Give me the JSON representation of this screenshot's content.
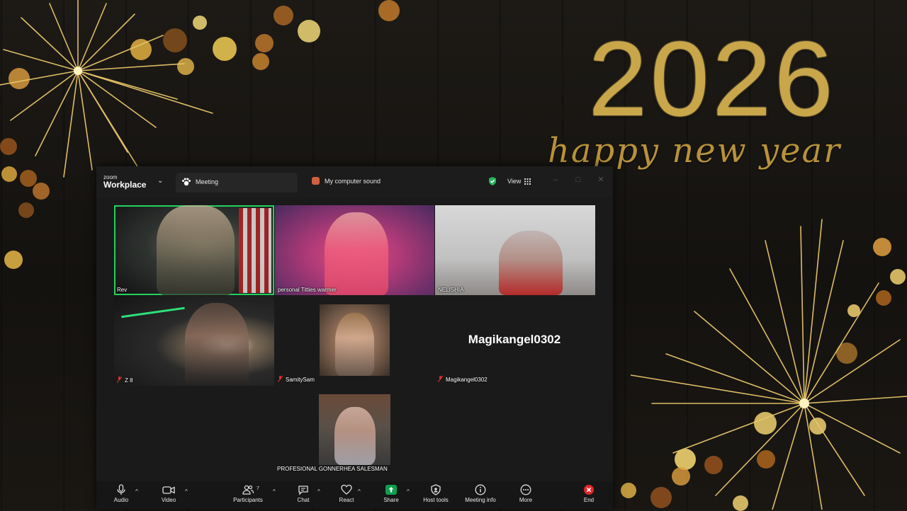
{
  "background": {
    "year": "2026",
    "greeting": "happy new year"
  },
  "app": {
    "brand_small": "zoom",
    "brand_big": "Workplace",
    "tabs": [
      {
        "label": "Meeting"
      },
      {
        "label": "My computer sound"
      }
    ],
    "view_label": "View"
  },
  "participants": [
    {
      "name": "Rev",
      "active": true
    },
    {
      "name": "personal Titties warmer"
    },
    {
      "name": "NELISHIA"
    },
    {
      "name": "Z 8",
      "muted": true
    },
    {
      "name": "SamitySam",
      "muted": true
    },
    {
      "name": "Magikangel0302",
      "muted": true,
      "video_off": true
    },
    {
      "name": "PROFESIONAL GONNERHEA SALESMAN"
    }
  ],
  "toolbar": {
    "audio": "Audio",
    "video": "Video",
    "participants": "Participants",
    "participant_count": "7",
    "chat": "Chat",
    "react": "React",
    "share": "Share",
    "host_tools": "Host tools",
    "meeting_info": "Meeting info",
    "more": "More",
    "end": "End"
  },
  "colors": {
    "active_speaker": "#23d160",
    "share_green": "#0e9f50",
    "end_red": "#e02828",
    "gold": "#c9a64a"
  }
}
